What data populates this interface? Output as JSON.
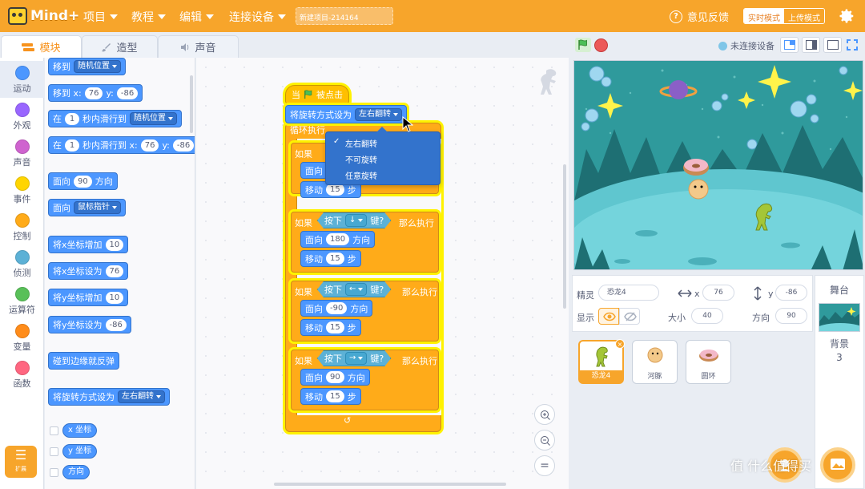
{
  "app": {
    "logo_text": "Mind+"
  },
  "menu": {
    "project": "项目",
    "tutorial": "教程",
    "edit": "编辑",
    "connect": "连接设备"
  },
  "project_name": "新建项目-214164",
  "header": {
    "feedback": "意见反馈",
    "mode_realtime": "实时模式",
    "mode_upload": "上传模式"
  },
  "tabs": {
    "blocks": "模块",
    "costumes": "造型",
    "sounds": "声音"
  },
  "device_status": "未连接设备",
  "categories": [
    {
      "label": "运动",
      "color": "#4c97ff"
    },
    {
      "label": "外观",
      "color": "#9966ff"
    },
    {
      "label": "声音",
      "color": "#cf63cf"
    },
    {
      "label": "事件",
      "color": "#ffd500"
    },
    {
      "label": "控制",
      "color": "#ffab19"
    },
    {
      "label": "侦测",
      "color": "#5cb1d6"
    },
    {
      "label": "运算符",
      "color": "#59c059"
    },
    {
      "label": "变量",
      "color": "#ff8c1a"
    },
    {
      "label": "函数",
      "color": "#ff6680"
    }
  ],
  "extension_label": "扩展",
  "palette": {
    "goto_label": "移到",
    "goto_target": "随机位置",
    "goto_xy_label": "移到 x:",
    "goto_xy_x": "76",
    "y_label": "y:",
    "goto_xy_y": "-86",
    "glide_in": "在",
    "glide_secs": "1",
    "glide_to": "秒内滑行到",
    "glide_target": "随机位置",
    "glide_xy_to": "秒内滑行到 x:",
    "glide_xy_x": "76",
    "glide_xy_y": "-86",
    "point_label": "面向",
    "point_value": "90",
    "point_unit": "方向",
    "point_towards_label": "面向",
    "point_towards_target": "鼠标指针",
    "change_x": "将x坐标增加",
    "change_x_value": "10",
    "set_x": "将x坐标设为",
    "set_x_value": "76",
    "change_y": "将y坐标增加",
    "change_y_value": "10",
    "set_y": "将y坐标设为",
    "set_y_value": "-86",
    "bounce": "碰到边缘就反弹",
    "rotation_style": "将旋转方式设为",
    "rotation_style_value": "左右翻转",
    "reporter_x": "x 坐标",
    "reporter_y": "y 坐标",
    "reporter_direction": "方向"
  },
  "script": {
    "hat_when": "当",
    "hat_clicked": "被点击",
    "rotation_style": "将旋转方式设为",
    "rotation_style_value": "左右翻转",
    "forever": "循环执行",
    "if_label": "如果",
    "key_press": "按下",
    "key_suffix": "键?",
    "then": "那么执行",
    "point_label": "面向",
    "dir_unit": "方向",
    "move_label": "移动",
    "move_unit": "步",
    "branch_1": {
      "dir": "",
      "move": "15"
    },
    "branch_2": {
      "key": "↓",
      "dir": "180",
      "move": "15"
    },
    "branch_3": {
      "key": "←",
      "dir": "-90",
      "move": "15"
    },
    "branch_4": {
      "key": "→",
      "dir": "90",
      "move": "15"
    },
    "loop_arrow": "↺"
  },
  "dropdown": {
    "options": [
      "左右翻转",
      "不可旋转",
      "任意旋转"
    ],
    "selected_mark": "✓"
  },
  "zoom": {
    "reset": "="
  },
  "sprite_info": {
    "sprite_label": "精灵",
    "sprite_name": "恐龙4",
    "x_label": "x",
    "x_value": "76",
    "y_label": "y",
    "y_value": "-86",
    "show_label": "显示",
    "size_label": "大小",
    "size_value": "40",
    "direction_label": "方向",
    "direction_value": "90"
  },
  "sprites": [
    {
      "name": "恐龙4",
      "active": true
    },
    {
      "name": "河豚",
      "active": false
    },
    {
      "name": "圆环",
      "active": false
    }
  ],
  "stage_panel": {
    "title": "舞台",
    "backdrop_label": "背景",
    "backdrop_count": "3"
  },
  "watermark": "值 什么值得买",
  "colors": {
    "accent": "#f7a52b",
    "motion": "#4c97ff",
    "control": "#ffab19",
    "event": "#ffbf00",
    "sensing": "#5cb1d6"
  }
}
